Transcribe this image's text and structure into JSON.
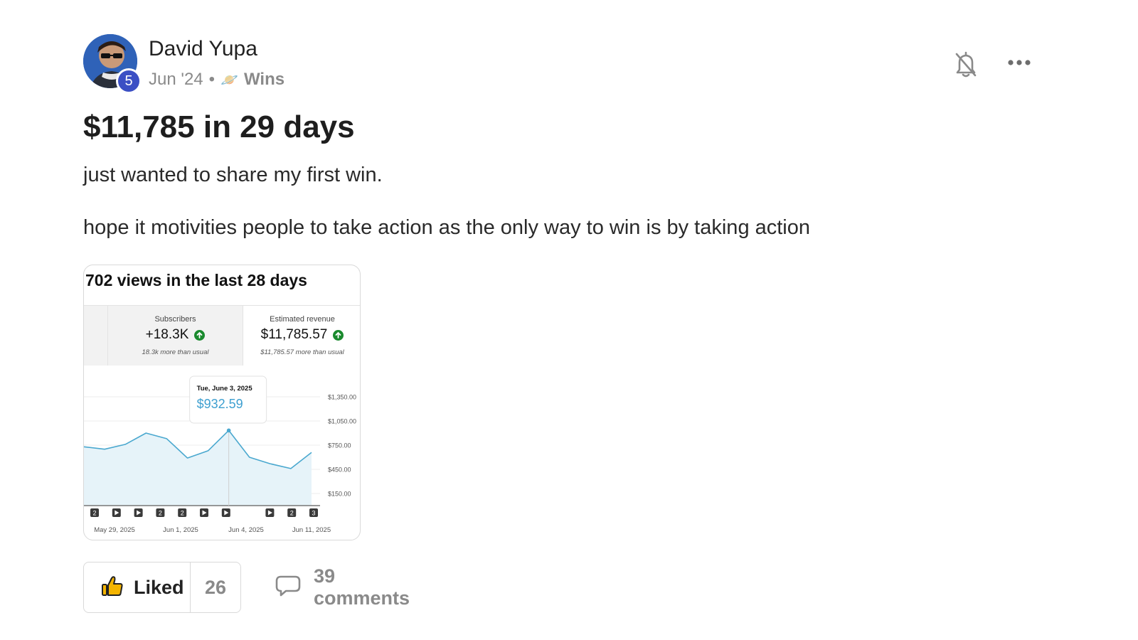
{
  "post": {
    "author": "David Yupa",
    "level": "5",
    "date": "Jun '24",
    "separator": "•",
    "category_emoji": "🪐",
    "category": "Wins",
    "title": "$11,785 in 29 days",
    "body_line1": "just wanted to share my first win.",
    "body_line2": "hope it motivities people to take action as the only way to win is by taking action"
  },
  "header_icons": {
    "bell": "bell-off-icon",
    "more": "more-horizontal-icon"
  },
  "screenshot": {
    "title": "702 views in the last 28 days",
    "stats": [
      {
        "label": "Subscribers",
        "value": "+18.3K",
        "note": "18.3k more than usual"
      },
      {
        "label": "Estimated revenue",
        "value": "$11,785.57",
        "note": "$11,785.57 more than usual"
      }
    ],
    "tooltip": {
      "date": "Tue, June 3, 2025",
      "value": "$932.59"
    },
    "chart_data": {
      "type": "area",
      "x_labels": [
        "May 29, 2025",
        "Jun 1, 2025",
        "Jun 4, 2025",
        "Jun 11, 2025"
      ],
      "y_ticks": [
        "$1,350.00",
        "$1,050.00",
        "$750.00",
        "$450.00",
        "$150.00"
      ],
      "y_tick_values": [
        1350,
        1050,
        750,
        450,
        150
      ],
      "values": [
        730,
        700,
        760,
        900,
        830,
        590,
        680,
        932.59,
        600,
        520,
        460,
        660
      ],
      "highlight_index": 7,
      "markers": [
        "2",
        "play",
        "play",
        "2",
        "2",
        "play",
        "play",
        "",
        "play",
        "2",
        "3"
      ],
      "colors": {
        "line": "#4aa8cf",
        "fill": "#e6f3f9"
      }
    }
  },
  "actions": {
    "like_label": "Liked",
    "like_count": "26",
    "comments_label": "39 comments"
  }
}
